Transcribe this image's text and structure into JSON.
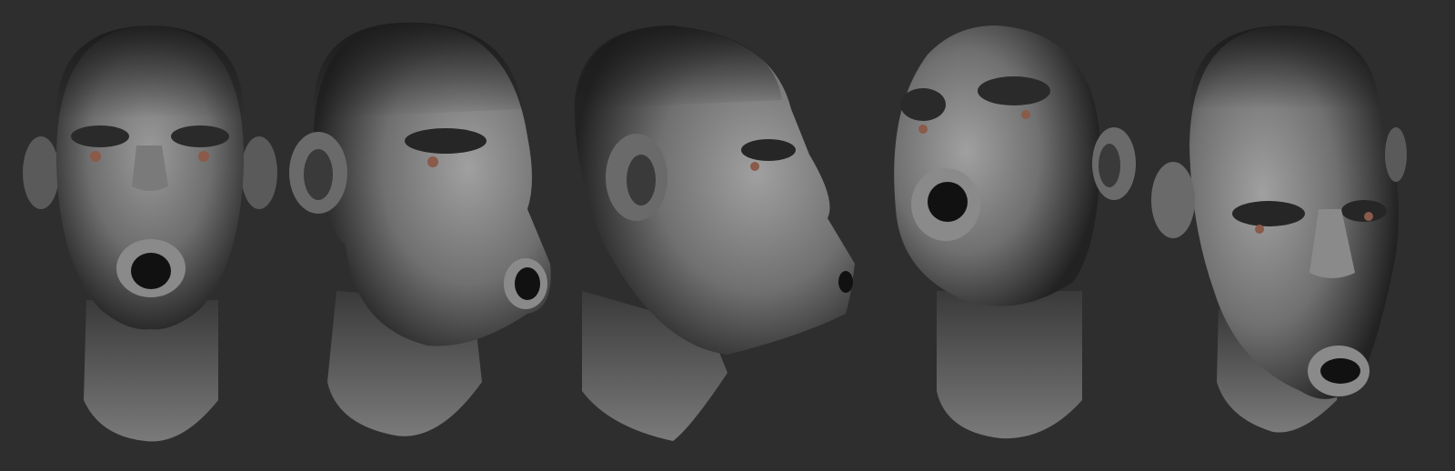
{
  "scene": {
    "background_color": "#2e2e2e",
    "material_light": "#9a9a9a",
    "material_mid": "#6a6a6a",
    "material_dark": "#1e1e1e",
    "iris_color": "#8a5a4a"
  }
}
